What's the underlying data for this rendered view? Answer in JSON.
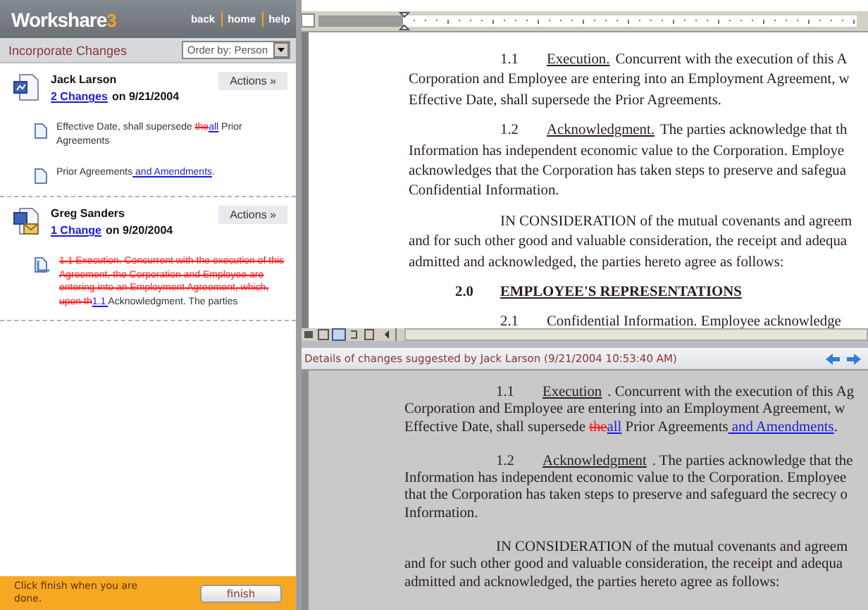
{
  "sidebar": {
    "logo": {
      "name": "Workshare",
      "version": "3"
    },
    "nav": [
      "back",
      "home",
      "help"
    ],
    "section_title": "Incorporate Changes",
    "order_by": {
      "value": "Order by: Person"
    },
    "authors": [
      {
        "name": "Jack Larson",
        "kind": "document",
        "changes_link": "2 Changes",
        "date": "on 9/21/2004",
        "actions": "Actions »",
        "changes": [
          {
            "kind": "edit",
            "parts": [
              {
                "kind": "text",
                "text": "Effective Date, shall supersede "
              },
              {
                "kind": "del",
                "text": "the"
              },
              {
                "kind": "ins",
                "text": "all"
              },
              {
                "kind": "text",
                "text": " Prior Agreements"
              }
            ]
          },
          {
            "kind": "edit",
            "parts": [
              {
                "kind": "text",
                "text": "Prior Agreements"
              },
              {
                "kind": "ins",
                "text": " and Amendments"
              },
              {
                "kind": "text",
                "text": "."
              }
            ]
          }
        ]
      },
      {
        "name": "Greg Sanders",
        "kind": "mail",
        "changes_link": "1 Change",
        "date": "on 9/20/2004",
        "actions": "Actions »",
        "changes": [
          {
            "kind": "move",
            "parts": [
              {
                "kind": "del",
                "text": "1.1  Execution.  Concurrent with the execution of this Agreement, the Corporation and Employee are entering into an Employment Agreement, which, upon th"
              },
              {
                "kind": "ins",
                "text": "1.1  "
              },
              {
                "kind": "text",
                "text": "Acknowledgment.  The parties"
              }
            ]
          }
        ]
      }
    ],
    "footer": {
      "hint": "Click finish when you are done.",
      "button": "finish"
    }
  },
  "document": {
    "paragraphs": [
      {
        "lines": [
          {
            "kind": "lead",
            "parts": [
              {
                "kind": "num",
                "text": "1.1"
              },
              {
                "kind": "title",
                "text": "Execution."
              },
              {
                "kind": "text",
                "text": "Concurrent with the execution of this A"
              }
            ]
          },
          {
            "kind": "body",
            "parts": [
              {
                "kind": "text",
                "text": "Corporation and Employee are entering into an Employment Agreement, w"
              }
            ]
          },
          {
            "kind": "body",
            "parts": [
              {
                "kind": "text",
                "text": "Effective Date, shall supersede the Prior Agreements."
              }
            ]
          }
        ]
      },
      {
        "lines": [
          {
            "kind": "lead",
            "parts": [
              {
                "kind": "num",
                "text": "1.2"
              },
              {
                "kind": "title",
                "text": "Acknowledgment."
              },
              {
                "kind": "text",
                "text": "The parties acknowledge that th"
              }
            ]
          },
          {
            "kind": "body",
            "parts": [
              {
                "kind": "text",
                "text": "Information has independent economic value to the Corporation. Employe"
              }
            ]
          },
          {
            "kind": "body",
            "parts": [
              {
                "kind": "text",
                "text": "acknowledges that the Corporation has taken steps to preserve and safegua"
              }
            ]
          },
          {
            "kind": "body",
            "parts": [
              {
                "kind": "text",
                "text": "Confidential Information."
              }
            ]
          }
        ]
      },
      {
        "lines": [
          {
            "kind": "lead",
            "parts": [
              {
                "kind": "text",
                "text": "IN CONSIDERATION of the mutual covenants and agreem"
              }
            ]
          },
          {
            "kind": "body",
            "parts": [
              {
                "kind": "text",
                "text": "and for such other good and valuable consideration, the receipt and adequa"
              }
            ]
          },
          {
            "kind": "body",
            "parts": [
              {
                "kind": "text",
                "text": "admitted and acknowledged, the parties hereto agree as follows:"
              }
            ]
          }
        ]
      },
      {
        "lines": [
          {
            "kind": "heading",
            "parts": [
              {
                "kind": "num",
                "text": "2.0"
              },
              {
                "kind": "title",
                "text": "EMPLOYEE'S REPRESENTATIONS"
              }
            ]
          }
        ]
      },
      {
        "lines": [
          {
            "kind": "lead",
            "parts": [
              {
                "kind": "num",
                "text": "2.1"
              },
              {
                "kind": "text",
                "text": "Confidential Information.  Employee acknowledge"
              }
            ]
          }
        ]
      }
    ]
  },
  "details": {
    "title": "Details of changes suggested by Jack Larson (9/21/2004 10:53:40 AM)",
    "paragraphs": [
      {
        "lines": [
          {
            "kind": "lead",
            "parts": [
              {
                "kind": "num",
                "text": "1.1"
              },
              {
                "kind": "title",
                "text": "Execution"
              },
              {
                "kind": "text",
                "text": ".  Concurrent with the execution of this Ag"
              }
            ]
          },
          {
            "kind": "body",
            "parts": [
              {
                "kind": "text",
                "text": "Corporation and Employee are entering into an Employment Agreement, w"
              }
            ]
          },
          {
            "kind": "body",
            "parts": [
              {
                "kind": "text",
                "text": "Effective Date, shall supersede "
              },
              {
                "kind": "del",
                "text": "the"
              },
              {
                "kind": "ins",
                "text": "all"
              },
              {
                "kind": "text",
                "text": " Prior Agreements"
              },
              {
                "kind": "ins",
                "text": " and Amendments"
              },
              {
                "kind": "text",
                "text": "."
              }
            ]
          }
        ]
      },
      {
        "lines": [
          {
            "kind": "lead",
            "parts": [
              {
                "kind": "num",
                "text": "1.2"
              },
              {
                "kind": "title",
                "text": "Acknowledgment"
              },
              {
                "kind": "text",
                "text": ".  The parties acknowledge that the"
              }
            ]
          },
          {
            "kind": "body",
            "parts": [
              {
                "kind": "text",
                "text": "Information has independent economic value to the Corporation. Employee"
              }
            ]
          },
          {
            "kind": "body",
            "parts": [
              {
                "kind": "text",
                "text": "that the Corporation has taken steps to preserve and safeguard the secrecy o"
              }
            ]
          },
          {
            "kind": "body",
            "parts": [
              {
                "kind": "text",
                "text": "Information."
              }
            ]
          }
        ]
      },
      {
        "lines": [
          {
            "kind": "lead",
            "parts": [
              {
                "kind": "text",
                "text": "IN CONSIDERATION of the mutual covenants and agreem"
              }
            ]
          },
          {
            "kind": "body",
            "parts": [
              {
                "kind": "text",
                "text": "and for such other good and valuable consideration, the receipt and adequa"
              }
            ]
          },
          {
            "kind": "body",
            "parts": [
              {
                "kind": "text",
                "text": "admitted and acknowledged, the parties hereto agree as follows:"
              }
            ]
          }
        ]
      }
    ]
  }
}
